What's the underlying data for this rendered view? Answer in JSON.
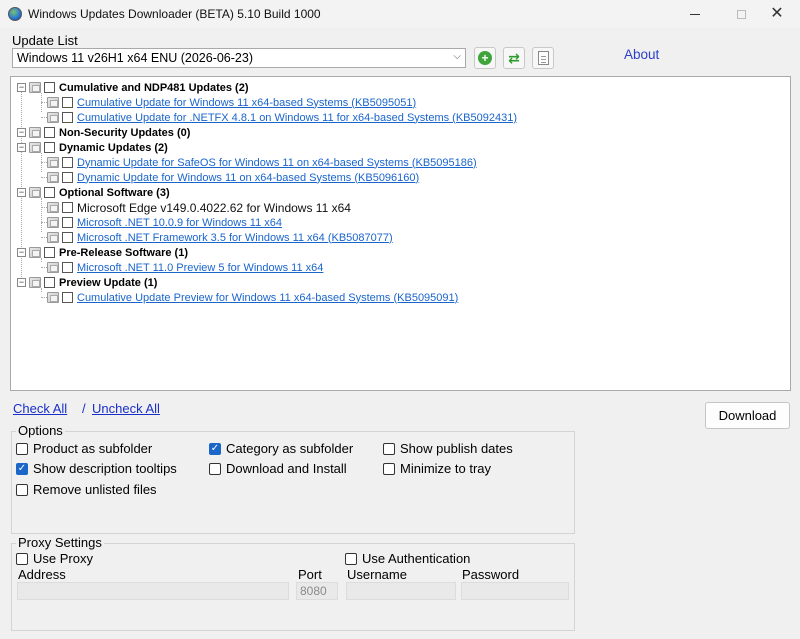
{
  "window": {
    "title": "Windows Updates Downloader (BETA) 5.10 Build 1000",
    "minimize": "—",
    "maximize": "▢",
    "close": "✕"
  },
  "update_list": {
    "label": "Update List",
    "selected": "Windows 11 v26H1 x64 ENU (2026-06-23)",
    "chevron": "⌵",
    "about": "About"
  },
  "tree": [
    {
      "name": "Cumulative and NDP481 Updates (2)",
      "items": [
        "Cumulative Update for Windows 11 x64-based Systems (KB5095051)",
        "Cumulative Update for .NETFX 4.8.1 on Windows 11 for x64-based Systems (KB5092431)"
      ]
    },
    {
      "name": "Non-Security Updates (0)",
      "items": []
    },
    {
      "name": "Dynamic Updates (2)",
      "items": [
        "Dynamic Update for SafeOS for Windows 11 on x64-based Systems (KB5095186)",
        "Dynamic Update for Windows 11 on x64-based Systems (KB5096160)"
      ]
    },
    {
      "name": "Optional Software (3)",
      "items": [
        "Microsoft Edge v149.0.4022.62 for Windows 11 x64",
        "Microsoft .NET 10.0.9 for Windows 11 x64",
        "Microsoft .NET Framework 3.5 for Windows 11 x64 (KB5087077)"
      ]
    },
    {
      "name": "Pre-Release Software (1)",
      "items": [
        "Microsoft .NET 11.0 Preview 5 for Windows 11 x64"
      ]
    },
    {
      "name": "Preview Update (1)",
      "items": [
        "Cumulative Update Preview for Windows 11 x64-based Systems (KB5095091)"
      ]
    }
  ],
  "actions": {
    "check_all": "Check All",
    "separator": "/",
    "uncheck_all": "Uncheck All",
    "download": "Download"
  },
  "options": {
    "title": "Options",
    "product_subfolder": {
      "label": "Product as subfolder",
      "checked": false
    },
    "category_subfolder": {
      "label": "Category as subfolder",
      "checked": true
    },
    "show_publish_dates": {
      "label": "Show publish dates",
      "checked": false
    },
    "show_tooltips": {
      "label": "Show description tooltips",
      "checked": true
    },
    "download_install": {
      "label": "Download and Install",
      "checked": false
    },
    "minimize_tray": {
      "label": "Minimize to tray",
      "checked": false
    },
    "remove_unlisted": {
      "label": "Remove unlisted files",
      "checked": false
    }
  },
  "proxy": {
    "title": "Proxy Settings",
    "use_proxy": {
      "label": "Use Proxy",
      "checked": false
    },
    "use_auth": {
      "label": "Use Authentication",
      "checked": false
    },
    "address_label": "Address",
    "port_label": "Port",
    "port_value": "8080",
    "username_label": "Username",
    "password_label": "Password"
  },
  "colors": {
    "link": "#1a65cc",
    "check": "#1a66c9",
    "about": "#2b3fc7"
  }
}
